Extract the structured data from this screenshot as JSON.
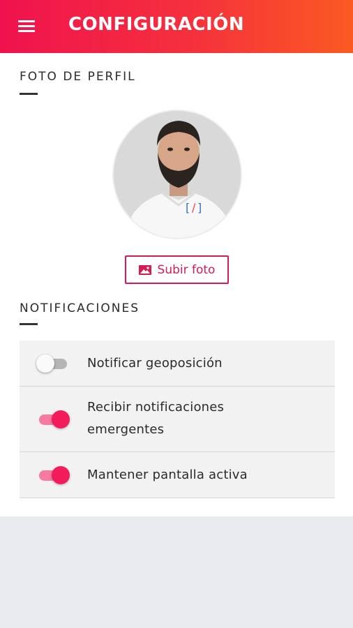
{
  "app_bar": {
    "title": "CONFIGURACIÓN",
    "menu_icon": "hamburger-menu-icon",
    "gradient_colors": [
      "#f0124e",
      "#fb5a22"
    ]
  },
  "profile_section": {
    "title": "FOTO DE PERFIL",
    "upload_button_label": "Subir foto",
    "upload_icon": "image-icon",
    "accent_color": "#d21c52"
  },
  "notifications_section": {
    "title": "NOTIFICACIONES",
    "items": [
      {
        "label": "Notificar geoposición",
        "enabled": false
      },
      {
        "label": "Recibir notificaciones emergentes",
        "enabled": true
      },
      {
        "label": "Mantener pantalla activa",
        "enabled": true
      }
    ]
  }
}
